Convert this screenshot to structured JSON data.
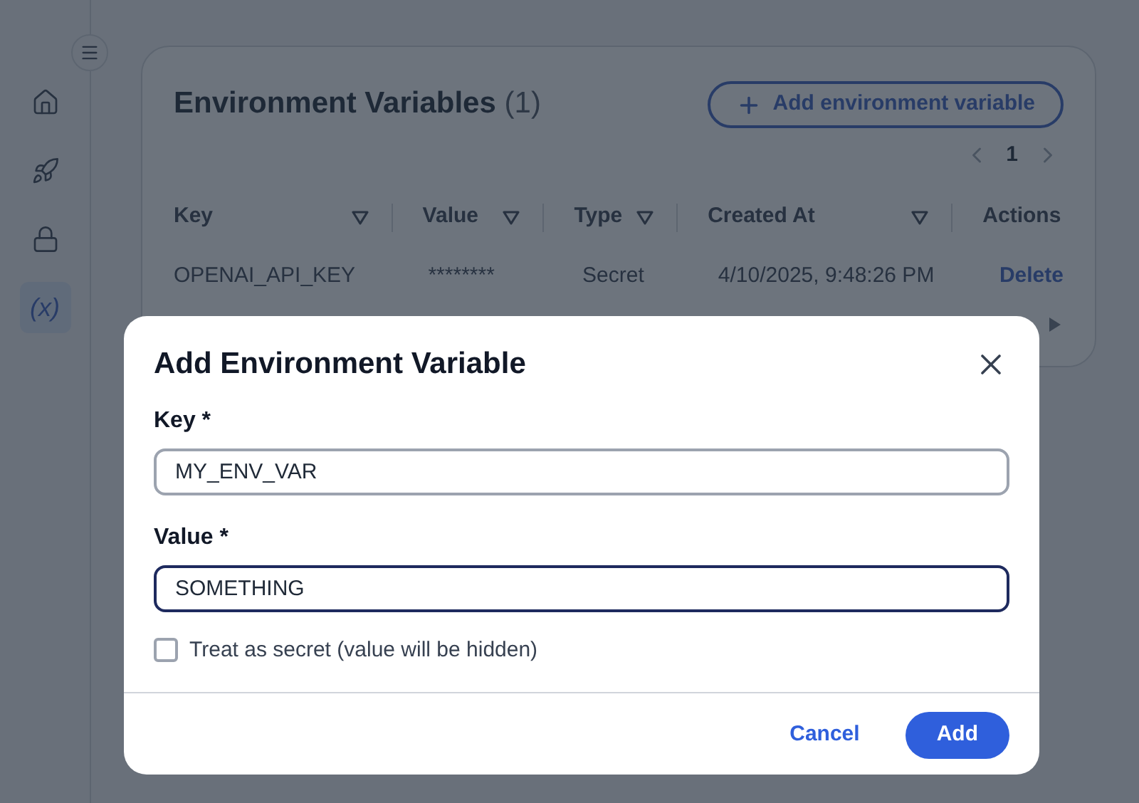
{
  "sidebar": {
    "items": [
      {
        "kind": "home",
        "selected": false
      },
      {
        "kind": "rocket",
        "selected": false
      },
      {
        "kind": "lock",
        "selected": false
      },
      {
        "kind": "text",
        "label": "(x)",
        "selected": true
      }
    ]
  },
  "panel": {
    "title": "Environment Variables",
    "count": "(1)",
    "add_button": "Add environment variable",
    "pagination": {
      "page": "1"
    },
    "table": {
      "columns": [
        {
          "label": "Key",
          "filter": true
        },
        {
          "label": "Value",
          "filter": true
        },
        {
          "label": "Type",
          "filter": true
        },
        {
          "label": "Created At",
          "filter": true
        },
        {
          "label": "Actions",
          "filter": false
        }
      ],
      "rows": [
        {
          "key": "OPENAI_API_KEY",
          "value": "********",
          "type": "Secret",
          "created_at": "4/10/2025, 9:48:26 PM",
          "action": "Delete"
        }
      ]
    }
  },
  "dialog": {
    "title": "Add Environment Variable",
    "fields": [
      {
        "label": "Key *",
        "value": "MY_ENV_VAR",
        "focused": false
      },
      {
        "label": "Value *",
        "value": "SOMETHING",
        "focused": true
      }
    ],
    "checkbox": {
      "label": "Treat as secret (value will be hidden)",
      "checked": false
    },
    "buttons": [
      {
        "label": "Cancel",
        "kind": "text"
      },
      {
        "label": "Add",
        "kind": "primary"
      }
    ]
  }
}
